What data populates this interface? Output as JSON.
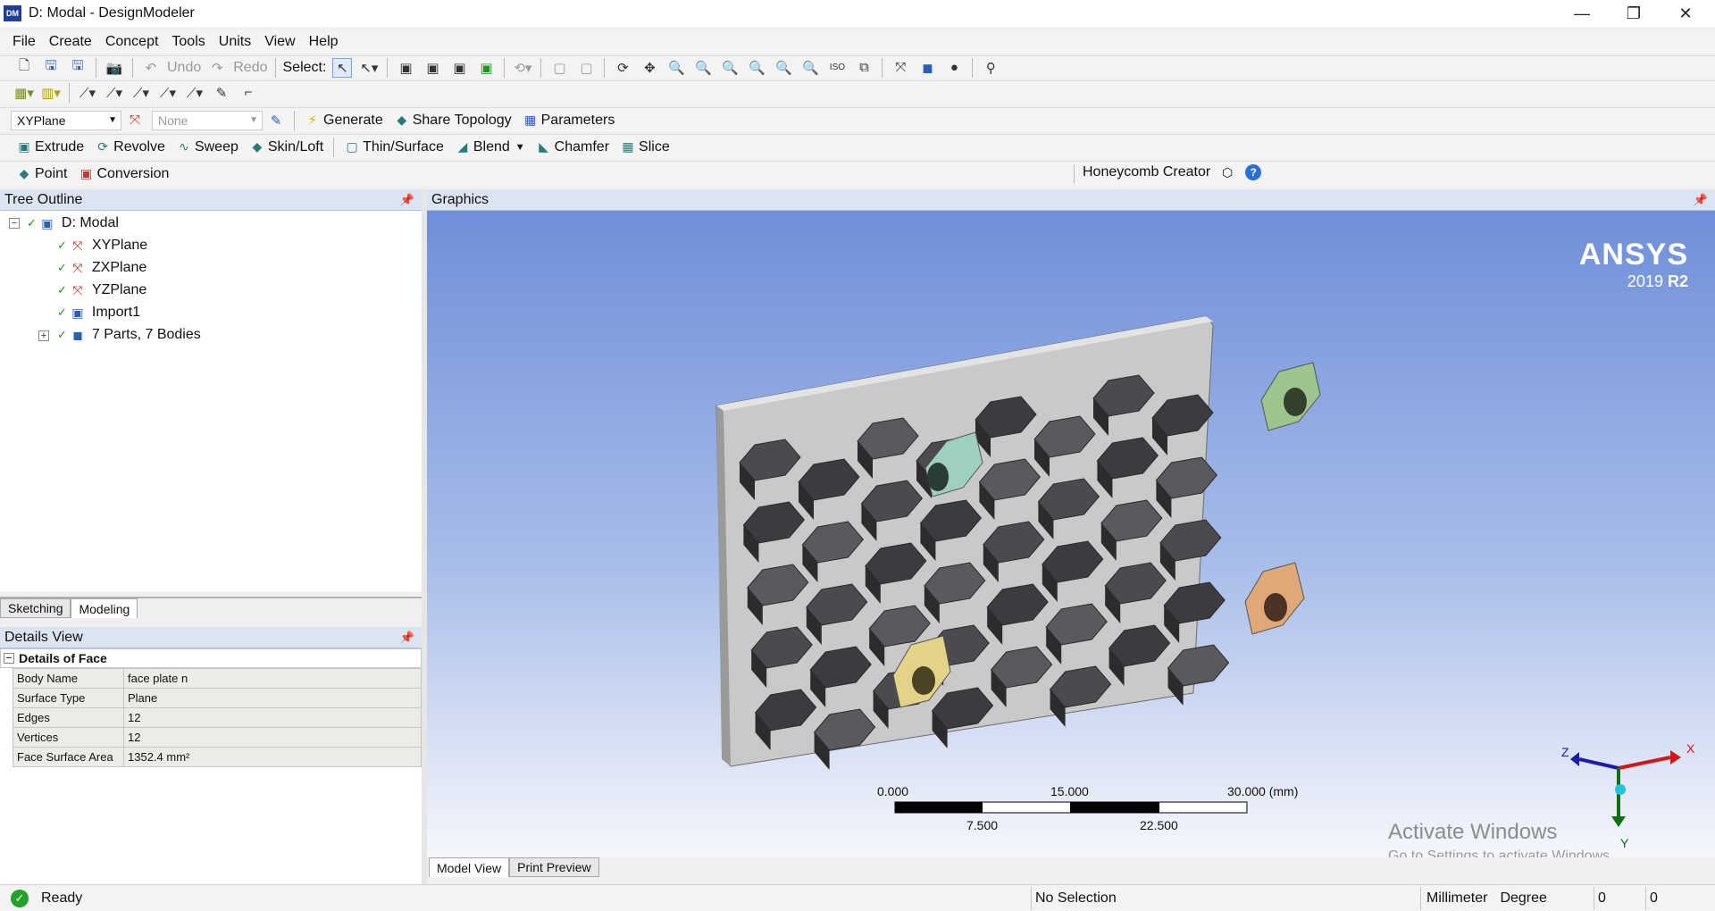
{
  "window": {
    "app_icon": "DM",
    "title": "D: Modal - DesignModeler",
    "minimize": "—",
    "maximize": "❐",
    "close": "✕"
  },
  "menu": [
    "File",
    "Create",
    "Concept",
    "Tools",
    "Units",
    "View",
    "Help"
  ],
  "toolbar1": {
    "undo": "Undo",
    "redo": "Redo",
    "select_label": "Select:"
  },
  "toolbar3": {
    "plane": "XYPlane",
    "sketch": "None",
    "generate": "Generate",
    "share_topology": "Share Topology",
    "parameters": "Parameters"
  },
  "toolbar4": {
    "extrude": "Extrude",
    "revolve": "Revolve",
    "sweep": "Sweep",
    "skin_loft": "Skin/Loft",
    "thin_surface": "Thin/Surface",
    "blend": "Blend",
    "chamfer": "Chamfer",
    "slice": "Slice"
  },
  "toolbar5": {
    "point": "Point",
    "conversion": "Conversion",
    "honeycomb": "Honeycomb Creator"
  },
  "tree": {
    "header": "Tree Outline",
    "root": "D: Modal",
    "nodes": [
      "XYPlane",
      "ZXPlane",
      "YZPlane",
      "Import1",
      "7 Parts, 7 Bodies"
    ]
  },
  "tabs": {
    "sketching": "Sketching",
    "modeling": "Modeling"
  },
  "details": {
    "header": "Details View",
    "title": "Details of Face",
    "rows": [
      {
        "key": "Body Name",
        "value": "face plate n"
      },
      {
        "key": "Surface Type",
        "value": "Plane"
      },
      {
        "key": "Edges",
        "value": "12"
      },
      {
        "key": "Vertices",
        "value": "12"
      },
      {
        "key": "Face Surface Area",
        "value": "1352.4 mm²"
      }
    ]
  },
  "graphics": {
    "header": "Graphics",
    "logo": "ANSYS",
    "version_year": "2019",
    "version_rel": "R2",
    "scale": {
      "top_labels": [
        "0.000",
        "15.000",
        "30.000 (mm)"
      ],
      "bottom_labels": [
        "7.500",
        "22.500"
      ]
    },
    "triad": {
      "x": "X",
      "y": "Y",
      "z": "Z"
    },
    "watermark_title": "Activate Windows",
    "watermark_sub": "Go to Settings to activate Windows."
  },
  "graphics_tabs": {
    "model_view": "Model View",
    "print_preview": "Print Preview"
  },
  "status": {
    "ready": "Ready",
    "selection": "No Selection",
    "units": "Millimeter",
    "angle": "Degree",
    "v1": "0",
    "v2": "0"
  }
}
